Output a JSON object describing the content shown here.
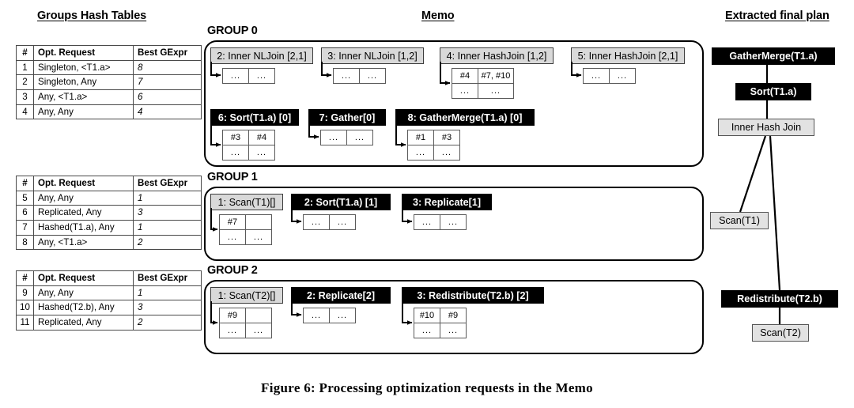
{
  "titles": {
    "hash_tables": "Groups Hash Tables",
    "memo": "Memo",
    "final_plan": "Extracted final plan"
  },
  "caption": "Figure 6:  Processing optimization requests in the Memo",
  "hash_tables": [
    {
      "name": "group-0-hash-table",
      "headers": [
        "#",
        "Opt. Request",
        "Best GExpr"
      ],
      "rows": [
        [
          "1",
          "Singleton,  <T1.a>",
          "8"
        ],
        [
          "2",
          "Singleton, Any",
          "7"
        ],
        [
          "3",
          "Any,  <T1.a>",
          "6"
        ],
        [
          "4",
          "Any,  Any",
          "4"
        ]
      ]
    },
    {
      "name": "group-1-hash-table",
      "headers": [
        "#",
        "Opt. Request",
        "Best GExpr"
      ],
      "rows": [
        [
          "5",
          "Any, Any",
          "1"
        ],
        [
          "6",
          "Replicated, Any",
          "3"
        ],
        [
          "7",
          "Hashed(T1.a), Any",
          "1"
        ],
        [
          "8",
          "Any, <T1.a>",
          "2"
        ]
      ]
    },
    {
      "name": "group-2-hash-table",
      "headers": [
        "#",
        "Opt. Request",
        "Best GExpr"
      ],
      "rows": [
        [
          "9",
          "Any, Any",
          "1"
        ],
        [
          "10",
          "Hashed(T2.b), Any",
          "3"
        ],
        [
          "11",
          "Replicated, Any",
          "2"
        ]
      ]
    }
  ],
  "memo": {
    "groups": [
      {
        "label": "GROUP 0",
        "expressions": [
          {
            "label": "2: Inner NLJoin [2,1]",
            "style": "light",
            "cells": [
              "...",
              "..."
            ]
          },
          {
            "label": "3: Inner NLJoin [1,2]",
            "style": "light",
            "cells": [
              "...",
              "..."
            ]
          },
          {
            "label": "4: Inner HashJoin [1,2]",
            "style": "light",
            "cells": [
              "#4",
              "#7, #10"
            ]
          },
          {
            "label": "5: Inner HashJoin [2,1]",
            "style": "light",
            "cells": [
              "...",
              "..."
            ]
          },
          {
            "label": "6: Sort(T1.a) [0]",
            "style": "dark",
            "cells": [
              "#3",
              "#4"
            ]
          },
          {
            "label": "7: Gather[0]",
            "style": "dark",
            "cells": [
              "...",
              "..."
            ]
          },
          {
            "label": "8: GatherMerge(T1.a) [0]",
            "style": "dark",
            "cells": [
              "#1",
              "#3"
            ]
          }
        ]
      },
      {
        "label": "GROUP 1",
        "expressions": [
          {
            "label": "1: Scan(T1)[]",
            "style": "light",
            "cells": [
              "#7",
              ""
            ]
          },
          {
            "label": "2: Sort(T1.a) [1]",
            "style": "dark",
            "cells": [
              "...",
              "..."
            ]
          },
          {
            "label": "3: Replicate[1]",
            "style": "dark",
            "cells": [
              "...",
              "..."
            ]
          }
        ]
      },
      {
        "label": "GROUP 2",
        "expressions": [
          {
            "label": "1: Scan(T2)[]",
            "style": "light",
            "cells": [
              "#9",
              ""
            ]
          },
          {
            "label": "2: Replicate[2]",
            "style": "dark",
            "cells": [
              "...",
              "..."
            ]
          },
          {
            "label": "3: Redistribute(T2.b) [2]",
            "style": "dark",
            "cells": [
              "#10",
              "#9"
            ]
          }
        ]
      }
    ],
    "row_dots": "..."
  },
  "final_plan": {
    "nodes": [
      {
        "label": "GatherMerge(T1.a)",
        "style": "dark"
      },
      {
        "label": "Sort(T1.a)",
        "style": "dark"
      },
      {
        "label": "Inner Hash Join",
        "style": "light"
      },
      {
        "label": "Scan(T1)",
        "style": "light"
      },
      {
        "label": "Redistribute(T2.b)",
        "style": "dark"
      },
      {
        "label": "Scan(T2)",
        "style": "light"
      }
    ]
  },
  "colors": {
    "dark_node_bg": "#000000",
    "light_node_bg": "#d9d9d9",
    "plan_light_bg": "#e2e2e2",
    "border": "#000000"
  }
}
